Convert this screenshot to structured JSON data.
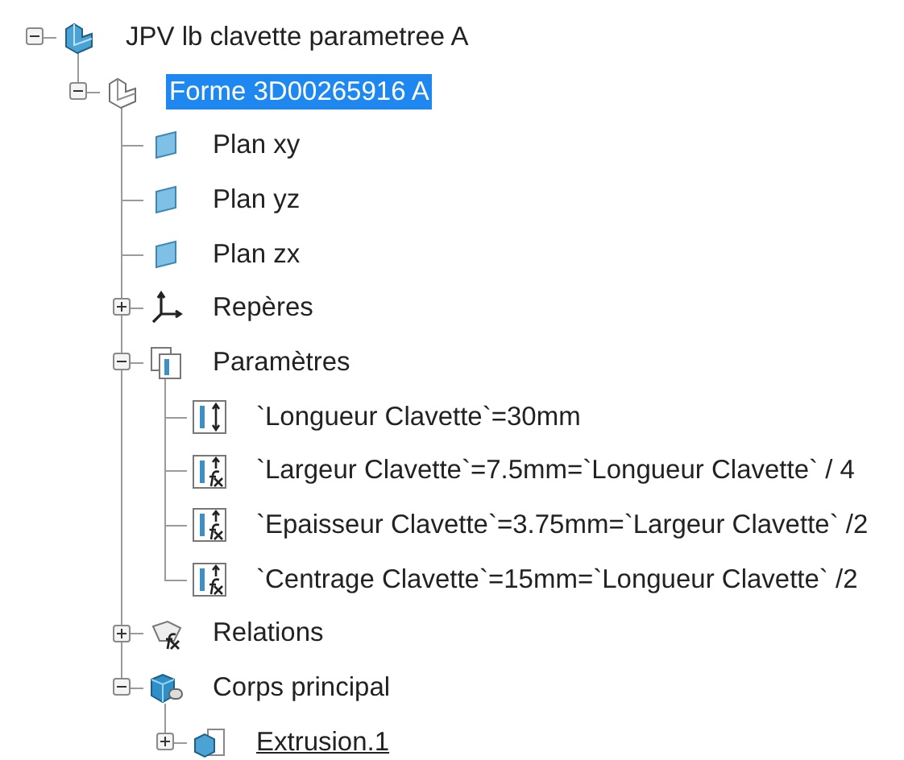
{
  "tree": [
    {
      "label": "JPV lb clavette parametree A",
      "kind": "part",
      "expanded": true,
      "selected": false,
      "active": false,
      "children": [
        {
          "label": "Forme 3D00265916 A",
          "kind": "shape",
          "expanded": true,
          "selected": true,
          "active": false,
          "children": [
            {
              "label": "Plan xy",
              "kind": "plane",
              "selected": false,
              "active": false
            },
            {
              "label": "Plan yz",
              "kind": "plane",
              "selected": false,
              "active": false
            },
            {
              "label": "Plan zx",
              "kind": "plane",
              "selected": false,
              "active": false
            },
            {
              "label": "Repères",
              "kind": "axes",
              "expanded": false,
              "selected": false,
              "active": false
            },
            {
              "label": "Paramètres",
              "kind": "params",
              "expanded": true,
              "selected": false,
              "active": false,
              "children": [
                {
                  "label": "`Longueur Clavette`=30mm",
                  "kind": "param",
                  "selected": false,
                  "active": false
                },
                {
                  "label": "`Largeur Clavette`=7.5mm=`Longueur Clavette` / 4",
                  "kind": "formula",
                  "selected": false,
                  "active": false
                },
                {
                  "label": "`Epaisseur Clavette`=3.75mm=`Largeur Clavette` /2",
                  "kind": "formula",
                  "selected": false,
                  "active": false
                },
                {
                  "label": "`Centrage Clavette`=15mm=`Longueur Clavette` /2",
                  "kind": "formula",
                  "selected": false,
                  "active": false
                }
              ]
            },
            {
              "label": "Relations",
              "kind": "relations",
              "expanded": false,
              "selected": false,
              "active": false
            },
            {
              "label": "Corps principal",
              "kind": "body",
              "expanded": true,
              "selected": false,
              "active": false,
              "children": [
                {
                  "label": "Extrusion.1",
                  "kind": "extrusion",
                  "expanded": false,
                  "selected": false,
                  "active": true
                }
              ]
            }
          ]
        }
      ]
    }
  ]
}
